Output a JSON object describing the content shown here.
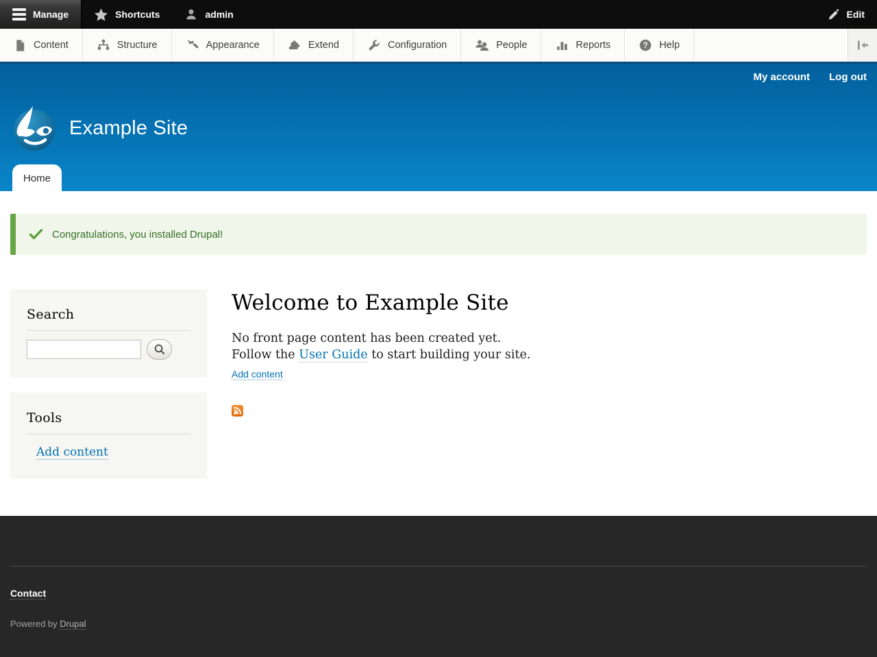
{
  "toolbar": {
    "manage": "Manage",
    "shortcuts": "Shortcuts",
    "user": "admin",
    "edit": "Edit"
  },
  "admin_menu": {
    "items": [
      {
        "label": "Content",
        "icon": "file-icon"
      },
      {
        "label": "Structure",
        "icon": "sitemap-icon"
      },
      {
        "label": "Appearance",
        "icon": "paintbrush-icon"
      },
      {
        "label": "Extend",
        "icon": "puzzle-icon"
      },
      {
        "label": "Configuration",
        "icon": "wrench-icon"
      },
      {
        "label": "People",
        "icon": "people-icon"
      },
      {
        "label": "Reports",
        "icon": "barchart-icon"
      },
      {
        "label": "Help",
        "icon": "question-icon"
      }
    ]
  },
  "header": {
    "site_name": "Example Site",
    "my_account": "My account",
    "log_out": "Log out",
    "home_tab": "Home"
  },
  "message": {
    "text": "Congratulations, you installed Drupal!"
  },
  "sidebar": {
    "search_title": "Search",
    "search_value": "",
    "tools_title": "Tools",
    "tools_link": "Add content"
  },
  "content": {
    "title": "Welcome to Example Site",
    "empty_text": "No front page content has been created yet.",
    "guide_prefix": "Follow the ",
    "guide_link": "User Guide",
    "guide_suffix": " to start building your site.",
    "add_content": "Add content"
  },
  "footer": {
    "contact": "Contact",
    "powered_prefix": "Powered by ",
    "powered_link": "Drupal"
  },
  "colors": {
    "toolbar_bg": "#0d0d0d",
    "tray_bg": "#fbfbf9",
    "header_gradient_top": "#04609e",
    "header_gradient_bottom": "#0a86c9",
    "message_border": "#65a544",
    "message_bg": "#f0f7ea",
    "message_text": "#356e24",
    "link_blue": "#0071b3",
    "sidebar_bg": "#f6f6f2",
    "footer_bg": "#272727",
    "rss_orange": "#ec7a10"
  }
}
